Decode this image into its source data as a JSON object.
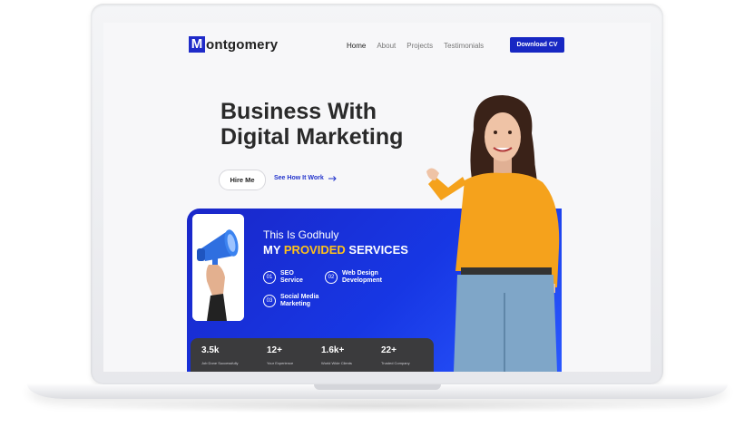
{
  "site": {
    "logo_letter": "M",
    "logo_rest": "ontgomery"
  },
  "nav": {
    "items": [
      "Home",
      "About",
      "Projects",
      "Testimonials"
    ],
    "cta": "Download CV"
  },
  "hero": {
    "line1": "Business With",
    "line2": "Digital Marketing",
    "primary_button": "Hire Me",
    "secondary_link": "See How It Work"
  },
  "services": {
    "subtitle": "This Is Godhuly",
    "title_prefix": "MY ",
    "title_highlight": "PROVIDED",
    "title_suffix": " SERVICES",
    "items": [
      {
        "num": "01",
        "label": "SEO\nService"
      },
      {
        "num": "02",
        "label": "Web Design\nDevelopment"
      },
      {
        "num": "03",
        "label": "Social Media\nMarketing"
      }
    ]
  },
  "stats": [
    {
      "value": "3.5k",
      "label": "Job Done Successfully"
    },
    {
      "value": "12+",
      "label": "Your Experience"
    },
    {
      "value": "1.6k+",
      "label": "World Wide Clients"
    },
    {
      "value": "22+",
      "label": "Trusted Company"
    }
  ],
  "colors": {
    "brand_blue": "#1727c3",
    "highlight_yellow": "#ffc21a",
    "stats_bg": "#3b3b3d"
  }
}
